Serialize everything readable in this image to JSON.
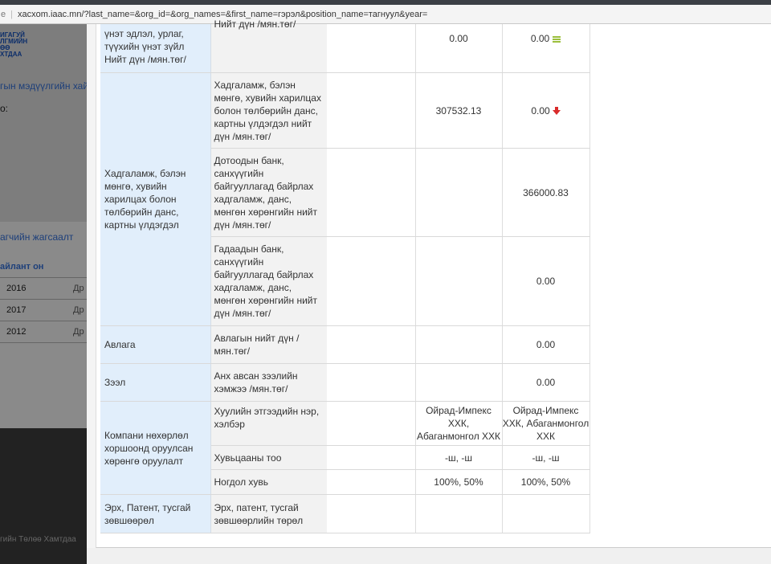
{
  "browser": {
    "url": "xacxom.iaac.mn/?last_name=&org_id=&org_names=&first_name=гэрэл&position_name=тагнуул&year=",
    "url_prefix": "e"
  },
  "background": {
    "logo_lines": [
      "ИГАГУЙ",
      "ЛГМИЙН",
      "ӨӨ",
      "ХТДАА"
    ],
    "link": "гын мэдүүлгийн хай",
    "colon": "о:",
    "tab": "агчийн жагсаалт",
    "table_head": "айлант он",
    "rows": [
      {
        "year": "2016",
        "text": "Др"
      },
      {
        "year": "2017",
        "text": "Др"
      },
      {
        "year": "2012",
        "text": "Др"
      }
    ],
    "footer": "гийн Төлөө Хамтдаа"
  },
  "table": {
    "rows": [
      {
        "category": "үнэт эдлэл, урлаг, түүхийн үнэт зүйл Нийт дүн /мян.төг/",
        "item": "Нийт дүн /мян.төг/",
        "v1": "0.00",
        "v2": "0.00",
        "icon": "lines-icon"
      },
      {
        "item": "Хадгаламж, бэлэн мөнгө, хувийн харилцах болон төлбөрийн данс, картны үлдэгдэл нийт дүн /мян.төг/",
        "v1": "307532.13",
        "v2": "0.00",
        "icon": "down-arrow-icon"
      },
      {
        "item": "Дотоодын банк, санхүүгийн байгууллагад байрлах хадгаламж, данс, мөнгөн хөрөнгийн нийт дүн /мян.төг/",
        "v1": "",
        "v2": "366000.83"
      },
      {
        "item": "Гадаадын банк, санхүүгийн байгууллагад байрлах хадгаламж, данс, мөнгөн хөрөнгийн нийт дүн /мян.төг/",
        "v1": "",
        "v2": "0.00"
      },
      {
        "category": "Авлага",
        "item": "Авлагын нийт дүн /мян.төг/",
        "v1": "",
        "v2": "0.00"
      },
      {
        "category": "Зээл",
        "item": "Анх авсан зээлийн хэмжээ /мян.төг/",
        "v1": "",
        "v2": "0.00"
      },
      {
        "item": "Хуулийн этгээдийн нэр, хэлбэр",
        "v1": "Ойрад-Импекс ХХК, Абаганмонгол ХХК",
        "v2": "Ойрад-Импекс ХХК, Абаганмонгол ХХК"
      },
      {
        "item": "Хувьцааны тоо",
        "v1": "-ш, -ш",
        "v2": "-ш, -ш"
      },
      {
        "item": "Ногдол хувь",
        "v1": "100%, 50%",
        "v2": "100%, 50%"
      },
      {
        "category": "Эрх, Патент, тусгай зөвшөөрөл",
        "item": "Эрх, патент, тусгай зөвшөөрлийн төрөл",
        "v1": "",
        "v2": ""
      }
    ],
    "groups": {
      "savings": "Хадгаламж, бэлэн мөнгө, хувийн харилцах болон төлбөрийн данс, картны үлдэгдэл",
      "company": "Компани нөхөрлөл хоршоонд оруулсан хөрөнгө оруулалт"
    }
  }
}
